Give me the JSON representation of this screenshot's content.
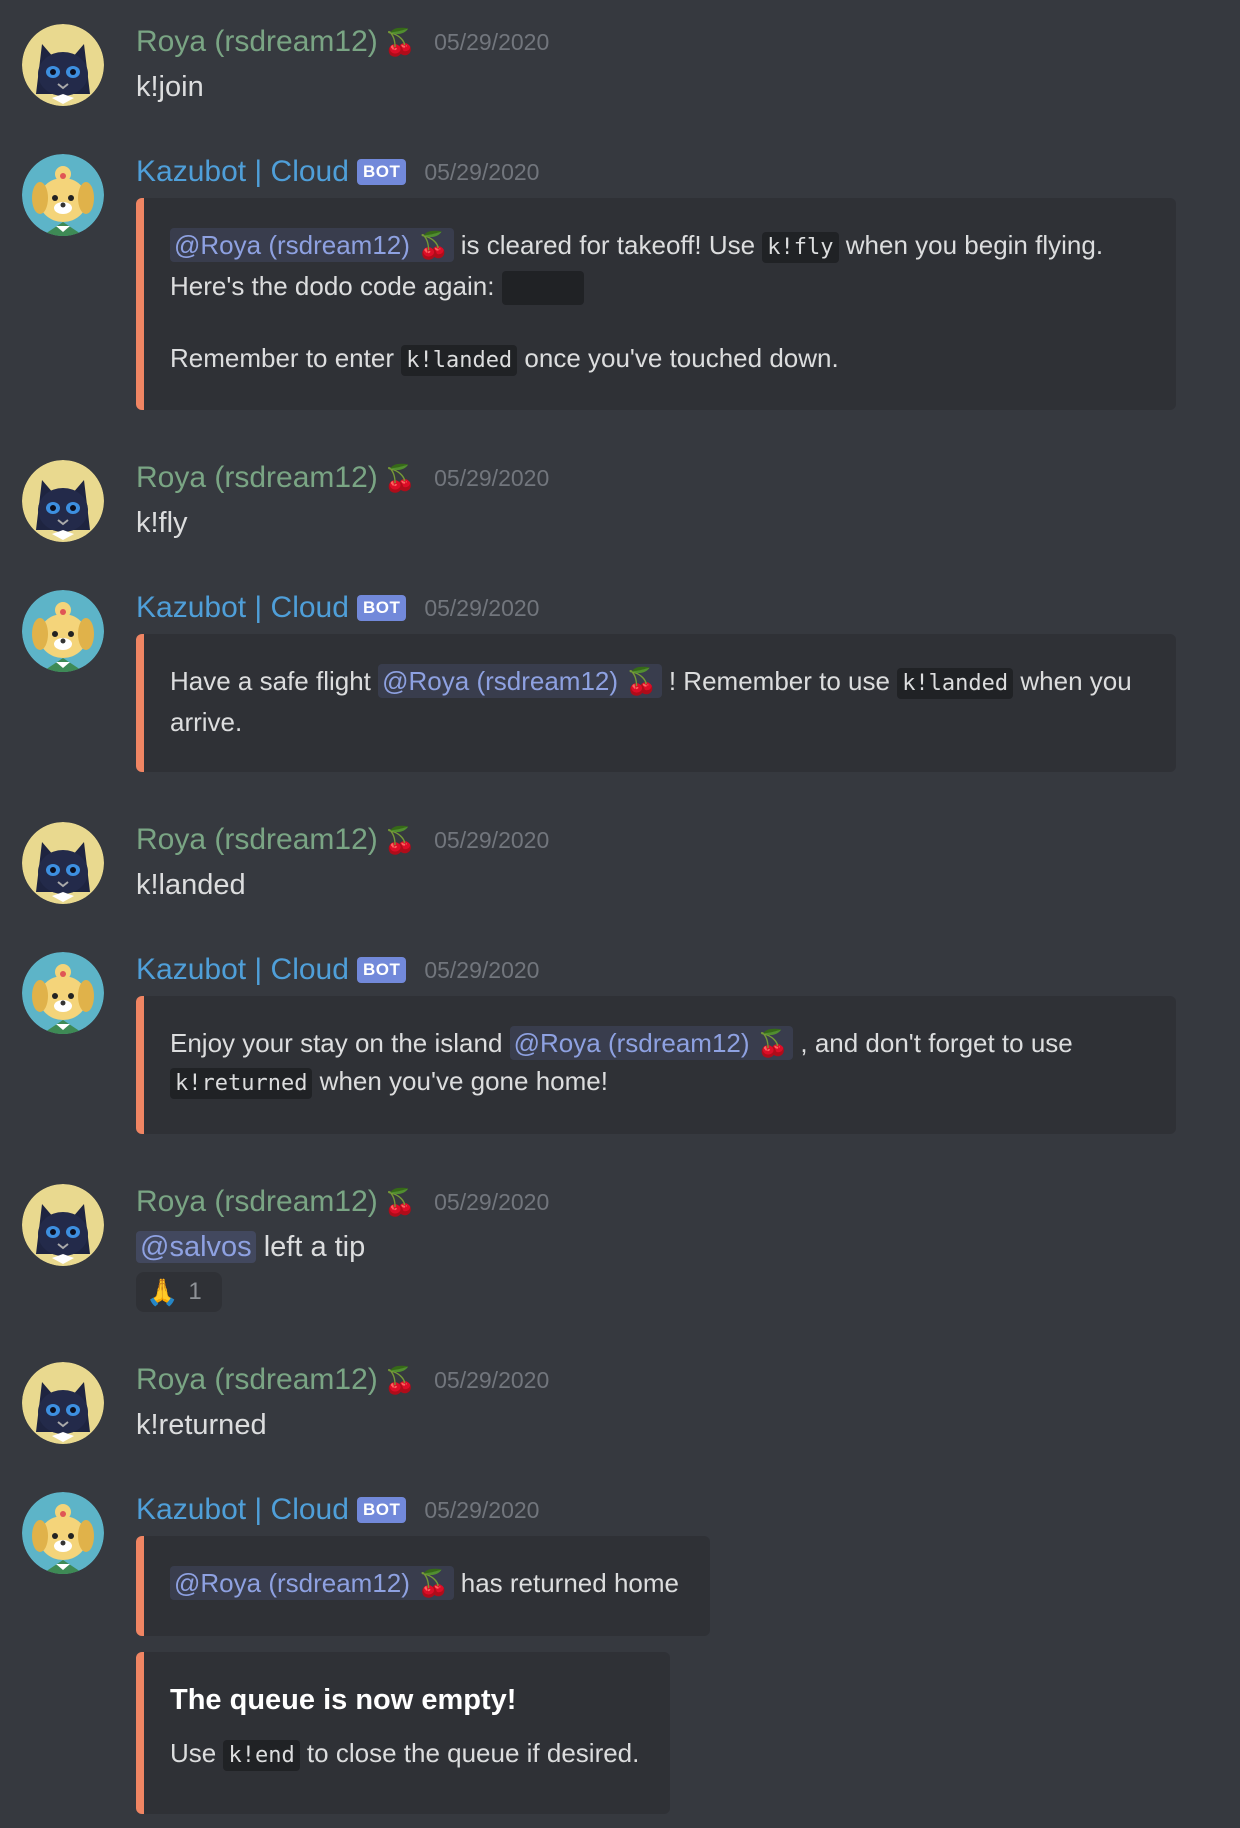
{
  "users": {
    "roya": {
      "name": "Roya (rsdream12)",
      "emoji": "🍒"
    },
    "bot": {
      "name": "Kazubot | Cloud",
      "tag": "BOT"
    }
  },
  "messages": [
    {
      "timestamp": "05/29/2020",
      "text": "k!join"
    },
    {
      "timestamp": "05/29/2020",
      "embed": {
        "mention": "@Roya (rsdream12) 🍒",
        "text_a": " is cleared for takeoff! Use ",
        "code_a": "k!fly",
        "text_b": " when you begin flying.",
        "line2": "Here's the dodo code again: ",
        "line3_a": "Remember to enter ",
        "code_b": "k!landed",
        "line3_b": " once you've touched down."
      }
    },
    {
      "timestamp": "05/29/2020",
      "text": "k!fly"
    },
    {
      "timestamp": "05/29/2020",
      "embed": {
        "text_a": "Have a safe flight ",
        "mention": "@Roya (rsdream12) 🍒",
        "text_b": " ! Remember to use ",
        "code_a": "k!landed",
        "text_c": " when you",
        "line2": "arrive."
      }
    },
    {
      "timestamp": "05/29/2020",
      "text": "k!landed"
    },
    {
      "timestamp": "05/29/2020",
      "embed": {
        "text_a": "Enjoy your stay on the island ",
        "mention": "@Roya (rsdream12) 🍒",
        "text_b": " , and don't forget to use",
        "code_a": "k!returned",
        "line2_b": " when you've gone home!"
      }
    },
    {
      "timestamp": "05/29/2020",
      "mention": "@salvos",
      "text": " left a tip",
      "reaction": {
        "emoji": "🙏",
        "count": "1"
      }
    },
    {
      "timestamp": "05/29/2020",
      "text": "k!returned"
    },
    {
      "timestamp": "05/29/2020",
      "embed1": {
        "mention": "@Roya (rsdream12) 🍒",
        "text": " has returned home"
      },
      "embed2": {
        "title": "The queue is now empty!",
        "text_a": "Use ",
        "code_a": "k!end",
        "text_b": " to close the queue if desired."
      }
    }
  ],
  "colors": {
    "background": "#36393f",
    "embed_bg": "#2f3136",
    "embed_accent": "#f08563",
    "roya_name": "#7aa584",
    "bot_name": "#4f9fd9",
    "mention": "#8ea1e1"
  },
  "icons": {
    "roya_avatar": "black-cat-avatar",
    "bot_avatar": "isabelle-dog-avatar",
    "reaction": "folded-hands"
  }
}
